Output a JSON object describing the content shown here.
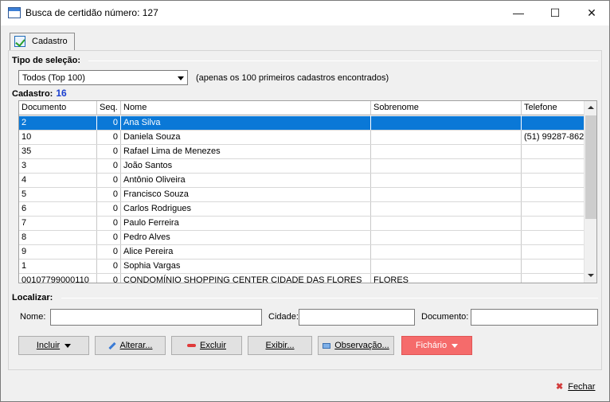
{
  "window": {
    "title": "Busca de certidão número: 127",
    "minimize": "—",
    "maximize": "☐",
    "close": "✕"
  },
  "tab": {
    "label": "Cadastro",
    "icon": "form-check-icon"
  },
  "selection": {
    "heading": "Tipo de seleção:",
    "value": "Todos (Top 100)",
    "note": "(apenas os 100 primeiros cadastros encontrados)"
  },
  "registry": {
    "heading": "Cadastro:",
    "count": "16"
  },
  "table": {
    "columns": [
      "Documento",
      "Seq.",
      "Nome",
      "Sobrenome",
      "Telefone"
    ],
    "rows": [
      [
        "2",
        "0",
        "Ana Silva",
        "",
        ""
      ],
      [
        "10",
        "0",
        "Daniela Souza",
        "",
        "(51) 99287-862"
      ],
      [
        "35",
        "0",
        "Rafael Lima de Menezes",
        "",
        ""
      ],
      [
        "3",
        "0",
        "João Santos",
        "",
        ""
      ],
      [
        "4",
        "0",
        "Antônio Oliveira",
        "",
        ""
      ],
      [
        "5",
        "0",
        "Francisco Souza",
        "",
        ""
      ],
      [
        "6",
        "0",
        "Carlos Rodrigues",
        "",
        ""
      ],
      [
        "7",
        "0",
        "Paulo Ferreira",
        "",
        ""
      ],
      [
        "8",
        "0",
        "Pedro Alves",
        "",
        ""
      ],
      [
        "9",
        "0",
        "Alice Pereira",
        "",
        ""
      ],
      [
        "1",
        "0",
        "Sophia Vargas",
        "",
        ""
      ],
      [
        "00107799000110",
        "0",
        "CONDOMÍNIO SHOPPING CENTER CIDADE DAS FLORES",
        "FLORES",
        ""
      ]
    ],
    "selected_row": 0
  },
  "locate": {
    "heading": "Localizar:",
    "name_label": "Nome:",
    "city_label": "Cidade:",
    "document_label": "Documento:",
    "name_value": "",
    "city_value": "",
    "document_value": ""
  },
  "buttons": {
    "incluir": "Incluir",
    "alterar": "Alterar...",
    "excluir": "Excluir",
    "exibir": "Exibir...",
    "observacao": "Observação...",
    "fichario": "Fichário",
    "fechar": "Fechar"
  },
  "colors": {
    "selection": "#0a78d7",
    "count": "#1a3fcf",
    "fichario": "#f56b6b",
    "close_icon": "#d23c3c"
  }
}
